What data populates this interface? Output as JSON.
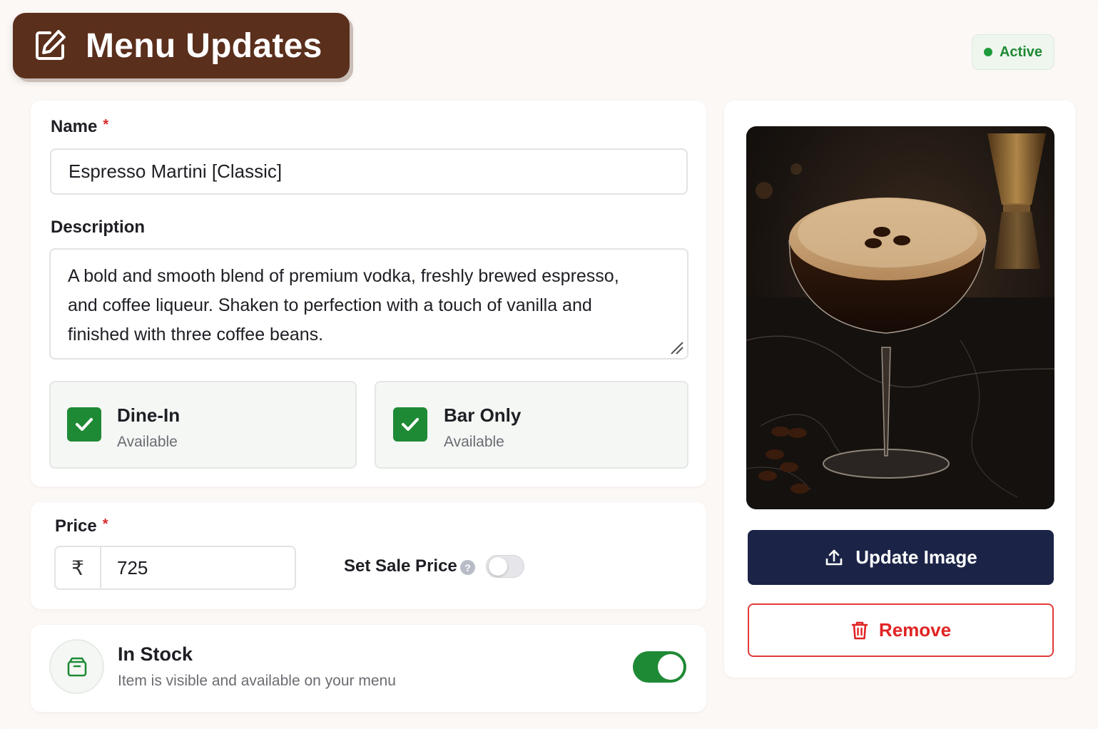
{
  "header": {
    "title": "Menu Updates",
    "icon": "edit-square-icon"
  },
  "status": {
    "label": "Active",
    "color": "#1f9a3a"
  },
  "form": {
    "name_label": "Name",
    "name_required": "*",
    "name_value": "Espresso Martini [Classic]",
    "description_label": "Description",
    "description_value": "A bold and smooth blend of premium vodka, freshly brewed espresso, and coffee liqueur. Shaken to perfection with a touch of vanilla and finished with three coffee beans.",
    "options": [
      {
        "title": "Dine-In",
        "subtitle": "Available",
        "checked": true
      },
      {
        "title": "Bar Only",
        "subtitle": "Available",
        "checked": true
      }
    ]
  },
  "price": {
    "label": "Price",
    "required": "*",
    "currency": "₹",
    "value": "725",
    "sale_label": "Set Sale Price",
    "help": "?",
    "sale_enabled": false
  },
  "stock": {
    "title": "In Stock",
    "subtitle": "Item is visible and available on your menu",
    "enabled": true,
    "icon": "box-icon"
  },
  "image_panel": {
    "update_label": "Update Image",
    "remove_label": "Remove"
  },
  "colors": {
    "brand_brown": "#5a2f1c",
    "navy": "#1b2447",
    "green": "#1f8a35",
    "danger": "#e02424"
  }
}
